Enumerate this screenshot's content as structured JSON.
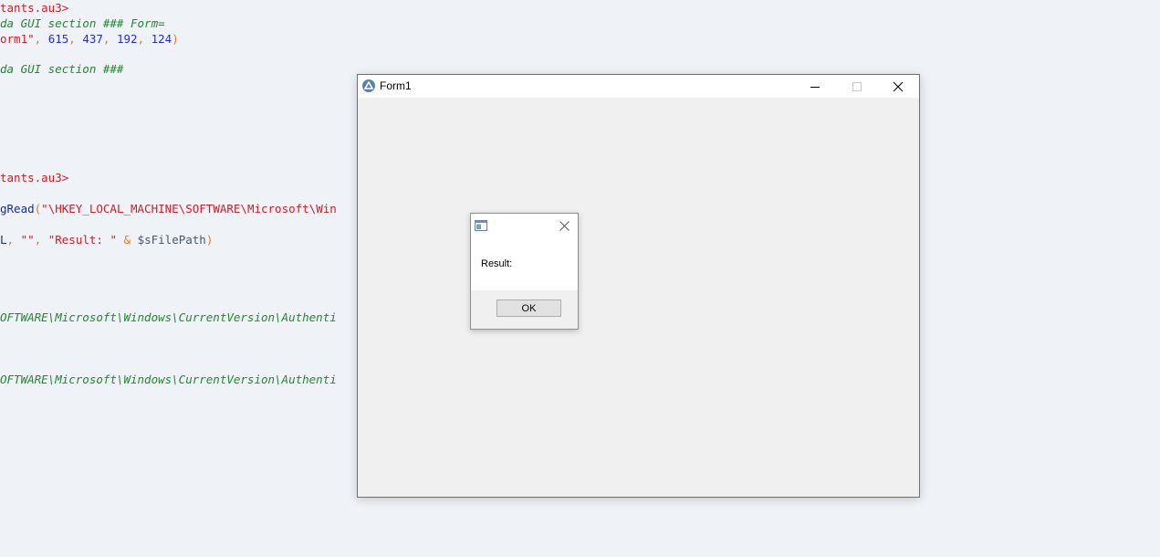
{
  "editor": {
    "lines": [
      {
        "segments": [
          {
            "text": "tants.au3>",
            "color": "red"
          }
        ]
      },
      {
        "segments": [
          {
            "text": "da GUI section ### Form=",
            "color": "green"
          }
        ]
      },
      {
        "segments": [
          {
            "text": "orm1\"",
            "color": "red"
          },
          {
            "text": ", ",
            "color": "orange"
          },
          {
            "text": "615",
            "color": "blue"
          },
          {
            "text": ", ",
            "color": "orange"
          },
          {
            "text": "437",
            "color": "blue"
          },
          {
            "text": ", ",
            "color": "orange"
          },
          {
            "text": "192",
            "color": "blue"
          },
          {
            "text": ", ",
            "color": "orange"
          },
          {
            "text": "124",
            "color": "blue"
          },
          {
            "text": ")",
            "color": "orange"
          }
        ]
      },
      {
        "segments": [
          {
            "text": "da GUI section ###",
            "color": "green"
          }
        ]
      },
      {
        "segments": [
          {
            "text": "tants.au3>",
            "color": "red"
          }
        ]
      },
      {
        "segments": [
          {
            "text": "gRead",
            "color": "navy"
          },
          {
            "text": "(",
            "color": "orange"
          },
          {
            "text": "\"\\HKEY_LOCAL_MACHINE\\SOFTWARE\\Microsoft\\Win",
            "color": "red"
          }
        ]
      },
      {
        "segments": [
          {
            "text": "L",
            "color": "navy"
          },
          {
            "text": ", ",
            "color": "orange"
          },
          {
            "text": "\"\"",
            "color": "red"
          },
          {
            "text": ", ",
            "color": "orange"
          },
          {
            "text": "\"Result: \"",
            "color": "red"
          },
          {
            "text": " & ",
            "color": "orange"
          },
          {
            "text": "$sFilePath",
            "color": "gray"
          },
          {
            "text": ")",
            "color": "orange"
          }
        ]
      },
      {
        "segments": [
          {
            "text": "OFTWARE\\Microsoft\\Windows\\CurrentVersion\\Authenti",
            "color": "green"
          }
        ]
      },
      {
        "segments": [
          {
            "text": "OFTWARE\\Microsoft\\Windows\\CurrentVersion\\Authenti",
            "color": "green"
          }
        ]
      }
    ]
  },
  "form": {
    "title": "Form1",
    "icon": "autoit-icon",
    "controls": {
      "minimize": "minimize-icon",
      "maximize": "maximize-icon",
      "close": "close-icon"
    }
  },
  "msgbox": {
    "icon": "window-icon",
    "text": "Result:",
    "ok_label": "OK"
  },
  "colors": {
    "red": "#c8202a",
    "green": "#1f8a2e",
    "blue": "#2b2bd0",
    "navy": "#1a2e8c",
    "gray": "#4c566a",
    "orange": "#e07b2c",
    "editor_bg": "#eff2f7",
    "form_bg": "#f0f0f0"
  }
}
